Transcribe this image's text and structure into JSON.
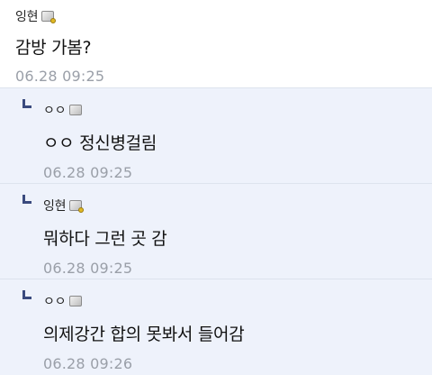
{
  "posts": [
    {
      "type": "comment",
      "author": "잉현",
      "author_icon": "nickname-badge-icon",
      "content": "감방 가봄?",
      "date": "06.28 09:25"
    },
    {
      "type": "reply",
      "author": "ㅇㅇ",
      "author_icon": "guest-badge-icon",
      "content": "ㅇㅇ 정신병걸림",
      "date": "06.28 09:25"
    },
    {
      "type": "reply",
      "author": "잉현",
      "author_icon": "nickname-badge-icon",
      "content": "뭐하다 그런 곳 감",
      "date": "06.28 09:25"
    },
    {
      "type": "reply",
      "author": "ㅇㅇ",
      "author_icon": "guest-badge-icon",
      "content": "의제강간 합의 못봐서 들어감",
      "date": "06.28 09:26"
    }
  ],
  "colors": {
    "reply_background": "#eef2fb",
    "divider": "#dde3ee",
    "reply_arrow": "#3a4a7e",
    "date_text": "#9a9fa8"
  }
}
